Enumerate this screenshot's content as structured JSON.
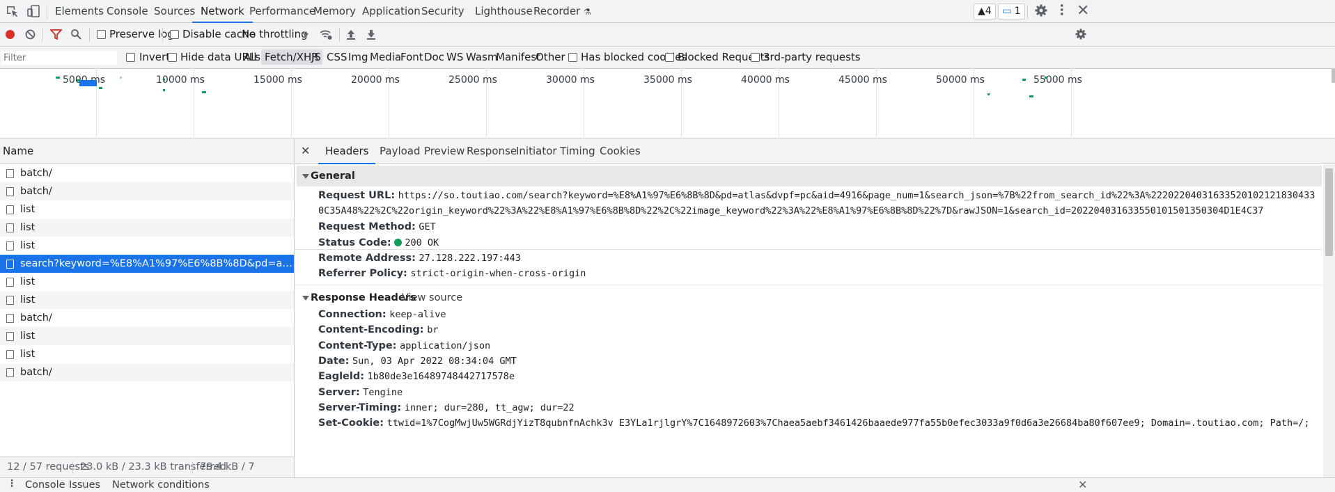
{
  "tabs": [
    "Elements",
    "Console",
    "Sources",
    "Network",
    "Performance",
    "Memory",
    "Application",
    "Security",
    "Lighthouse",
    "Recorder"
  ],
  "badges": {
    "warnings": "4",
    "messages": "1"
  },
  "toolbar": {
    "preserve_log": "Preserve log",
    "disable_cache": "Disable cache",
    "throttling": "No throttling"
  },
  "filterbar": {
    "filter_placeholder": "Filter",
    "invert": "Invert",
    "hide_data_urls": "Hide data URLs",
    "types": [
      "All",
      "Fetch/XHR",
      "JS",
      "CSS",
      "Img",
      "Media",
      "Font",
      "Doc",
      "WS",
      "Wasm",
      "Manifest",
      "Other"
    ],
    "has_blocked_cookies": "Has blocked cookies",
    "blocked_requests": "Blocked Requests",
    "third_party": "3rd-party requests"
  },
  "overview_labels": [
    "5000 ms",
    "10000 ms",
    "15000 ms",
    "20000 ms",
    "25000 ms",
    "30000 ms",
    "35000 ms",
    "40000 ms",
    "45000 ms",
    "50000 ms",
    "55000 ms"
  ],
  "name_header": "Name",
  "requests": [
    {
      "name": "batch/",
      "selected": false
    },
    {
      "name": "batch/",
      "selected": false
    },
    {
      "name": "list",
      "selected": false
    },
    {
      "name": "list",
      "selected": false
    },
    {
      "name": "list",
      "selected": false
    },
    {
      "name": "search?keyword=%E8%A1%97%E6%8B%8D&pd=atlas&...",
      "selected": true
    },
    {
      "name": "list",
      "selected": false
    },
    {
      "name": "list",
      "selected": false
    },
    {
      "name": "batch/",
      "selected": false
    },
    {
      "name": "list",
      "selected": false
    },
    {
      "name": "list",
      "selected": false
    },
    {
      "name": "batch/",
      "selected": false
    }
  ],
  "status": {
    "requests": "12 / 57 requests",
    "transferred": "23.0 kB / 23.3 kB transferred",
    "resources": "79.4 kB / 7"
  },
  "detail_tabs": [
    "Headers",
    "Payload",
    "Preview",
    "Response",
    "Initiator",
    "Timing",
    "Cookies"
  ],
  "general": {
    "title": "General",
    "url_label": "Request URL:",
    "url_line1": "https://so.toutiao.com/search?keyword=%E8%A1%97%E6%8B%8D&pd=atlas&dvpf=pc&aid=4916&page_num=1&search_json=%7B%22from_search_id%22%3A%22202204031633520102121830433",
    "url_line2": "0C35A48%22%2C%22origin_keyword%22%3A%22%E8%A1%97%E6%8B%8D%22%2C%22image_keyword%22%3A%22%E8%A1%97%E6%8B%8D%22%7D&rawJSON=1&search_id=202204031633550101501350304D1E4C37",
    "method_label": "Request Method:",
    "method": "GET",
    "status_label": "Status Code:",
    "status": "200 OK",
    "remote_label": "Remote Address:",
    "remote": "27.128.222.197:443",
    "referrer_label": "Referrer Policy:",
    "referrer": "strict-origin-when-cross-origin"
  },
  "response": {
    "title": "Response Headers",
    "view_source": "View source",
    "headers": [
      {
        "k": "Connection:",
        "v": "keep-alive"
      },
      {
        "k": "Content-Encoding:",
        "v": "br"
      },
      {
        "k": "Content-Type:",
        "v": "application/json"
      },
      {
        "k": "Date:",
        "v": "Sun, 03 Apr 2022 08:34:04 GMT"
      },
      {
        "k": "Eagleld:",
        "v": "1b80de3e16489748442717578e"
      },
      {
        "k": "Server:",
        "v": "Tengine"
      },
      {
        "k": "Server-Timing:",
        "v": "inner; dur=280, tt_agw; dur=22"
      },
      {
        "k": "Set-Cookie:",
        "v": "ttwid=1%7CogMwjUw5WGRdjYizT8qubnfnAchk3v E3YLa1rjlgrY%7C1648972603%7Chaea5aebf3461426baaede977fa55b0efec3033a9f0d6a3e26684ba80f607ee9; Domain=.toutiao.com; Path=/;"
      }
    ]
  },
  "drawer": [
    "Console",
    "Issues",
    "Network conditions"
  ],
  "colors": {
    "accent": "#1a73e8",
    "record": "#d93025",
    "ok": "#0f9d58"
  }
}
